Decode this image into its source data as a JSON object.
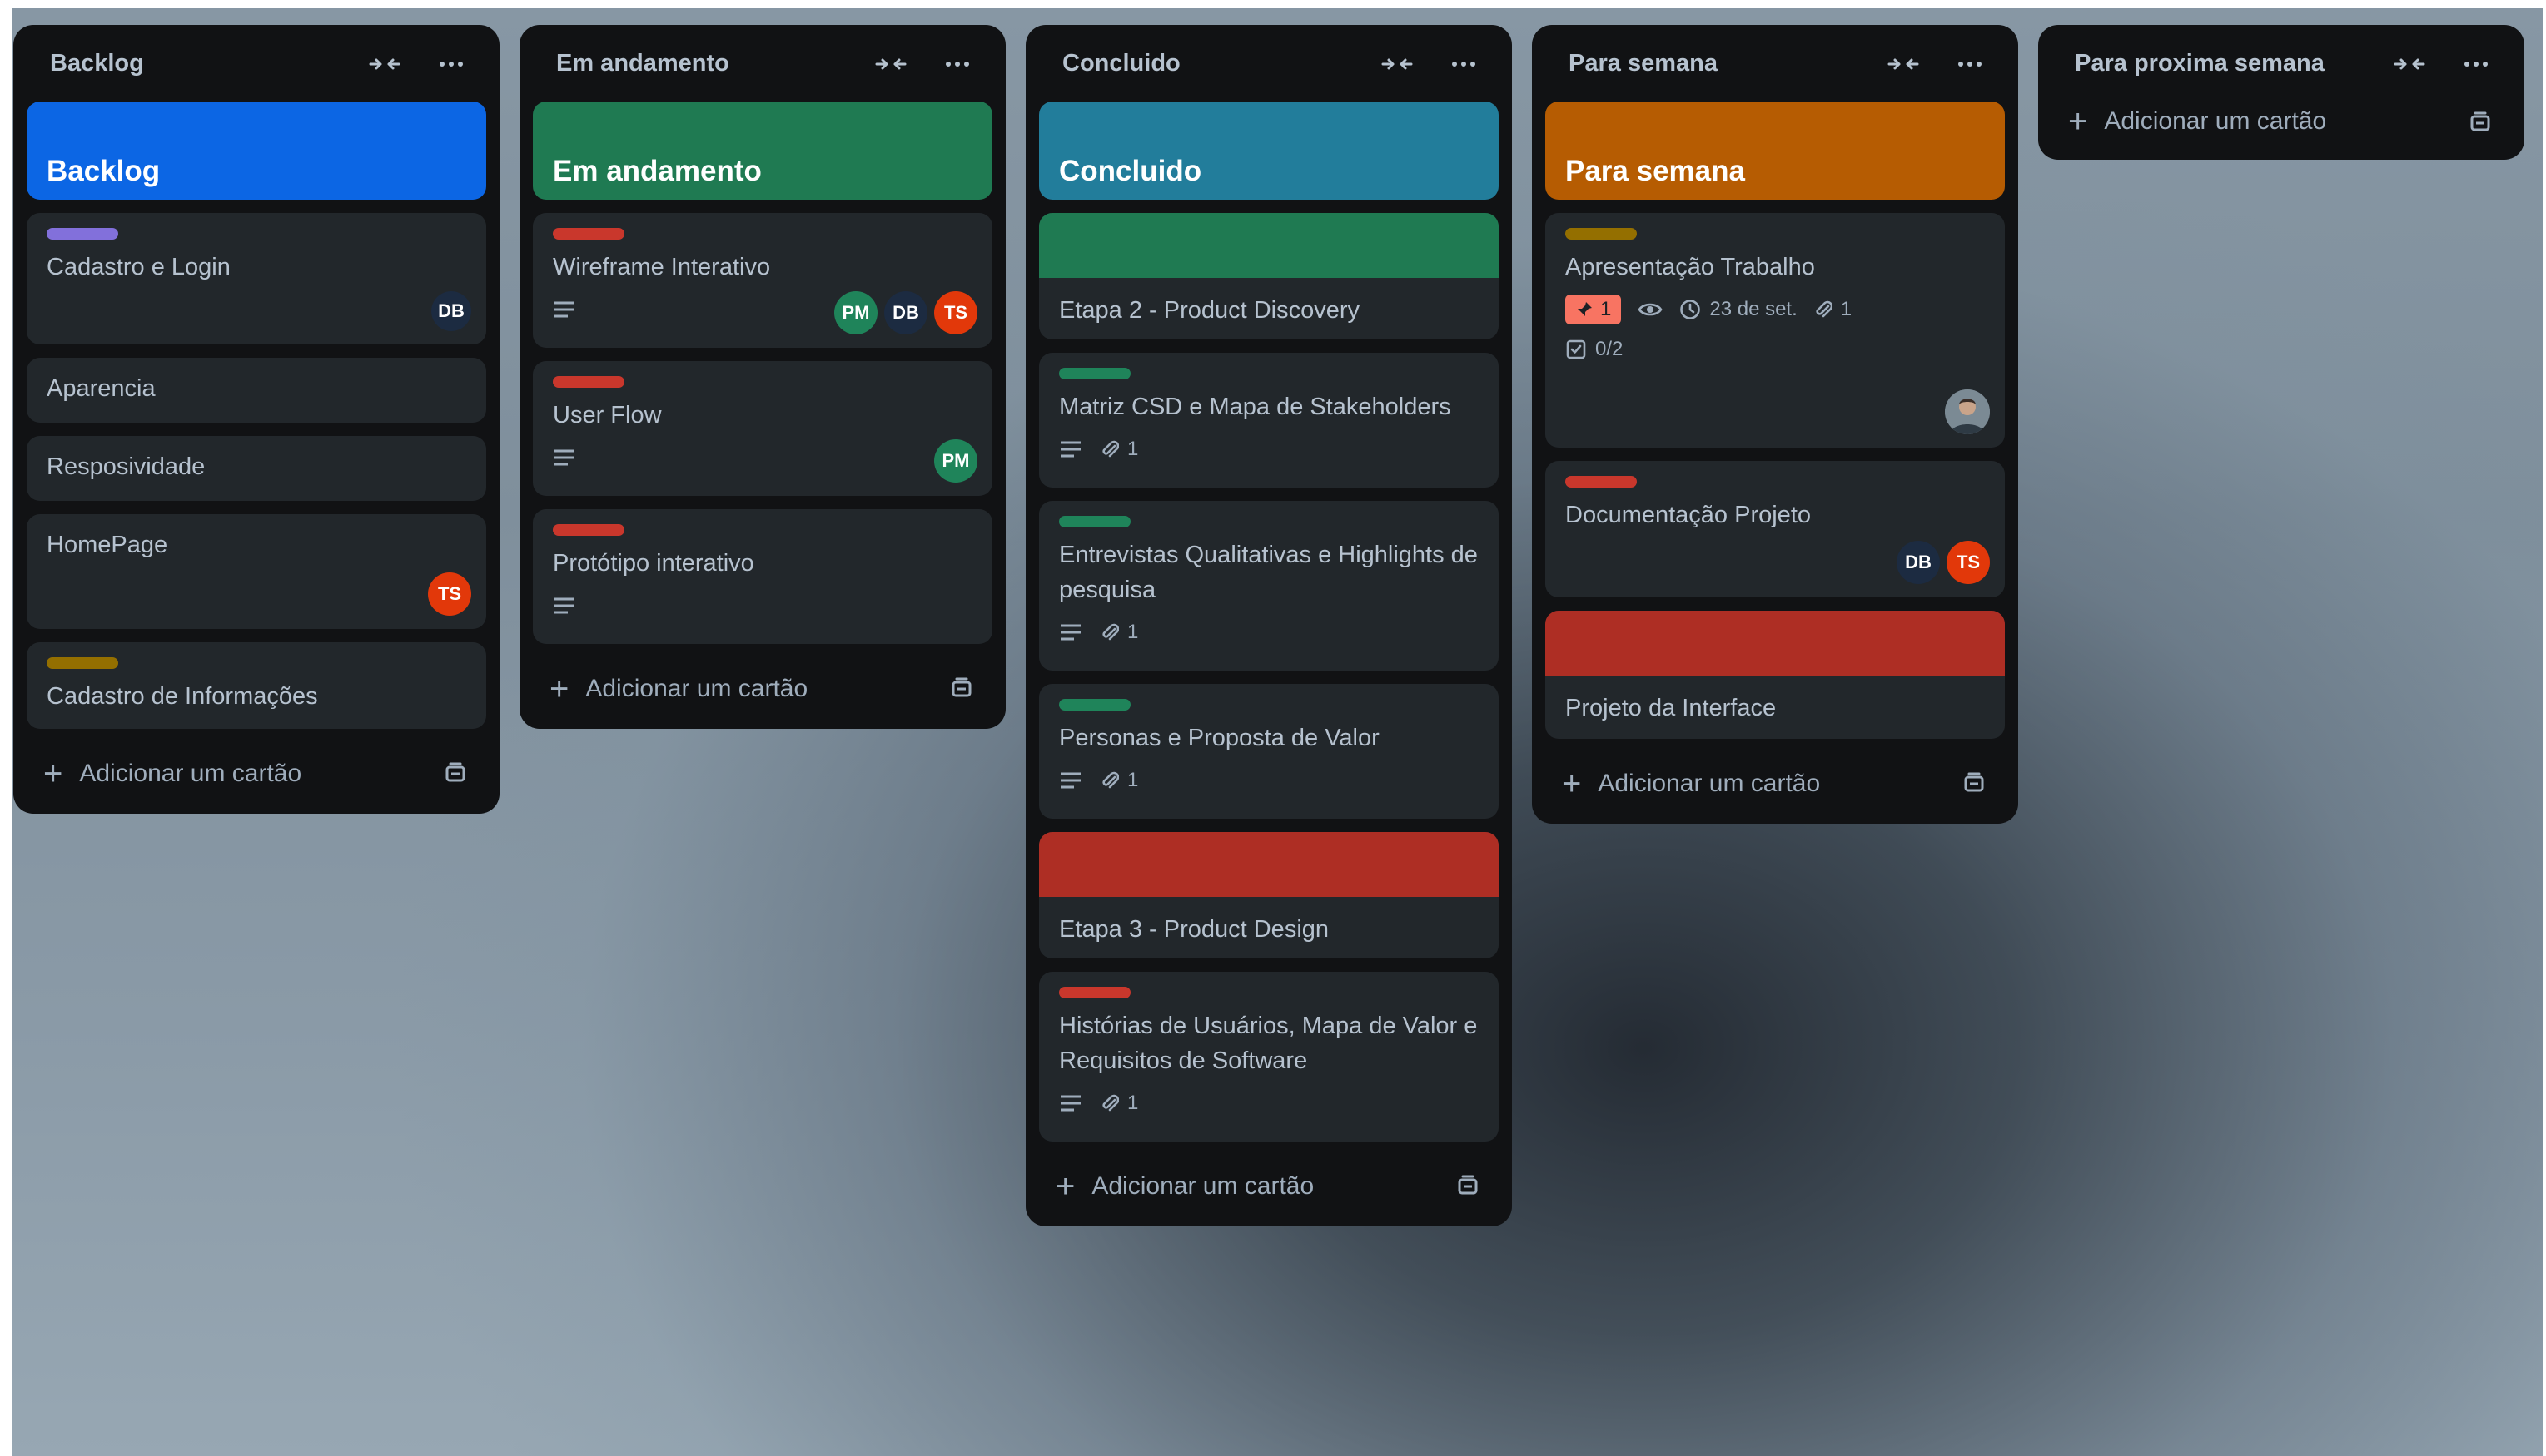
{
  "board": {
    "add_card_label": "Adicionar um cartão",
    "colors": {
      "list_bg": "#111214",
      "card_bg": "#22272b",
      "text": "#b6c2cf",
      "blue": "#0055cc",
      "green": "#216e4e",
      "teal": "#206a83",
      "orange": "#a54800",
      "red": "#ae2e24",
      "purple": "#6e5dc6",
      "label_red": "#c9372c",
      "label_green": "#1f845a",
      "label_yellow": "#946f00"
    },
    "lists": [
      {
        "title": "Backlog",
        "header_card": {
          "title": "Backlog",
          "color": "#0055cc"
        },
        "cards": [
          {
            "title": "Cadastro e Login",
            "label_color": "#6e5dc6",
            "members": [
              "DB"
            ]
          },
          {
            "title": "Aparencia"
          },
          {
            "title": "Resposividade"
          },
          {
            "title": "HomePage",
            "members": [
              "TS"
            ]
          },
          {
            "title": "Cadastro de Informações",
            "label_color": "#946f00"
          }
        ]
      },
      {
        "title": "Em andamento",
        "header_card": {
          "title": "Em andamento",
          "color": "#216e4e"
        },
        "cards": [
          {
            "title": "Wireframe Interativo",
            "label_color": "#c9372c",
            "has_description": true,
            "members": [
              "PM",
              "DB",
              "TS"
            ]
          },
          {
            "title": "User Flow",
            "label_color": "#c9372c",
            "has_description": true,
            "members": [
              "PM"
            ]
          },
          {
            "title": "Protótipo interativo",
            "label_color": "#c9372c",
            "has_description": true
          }
        ]
      },
      {
        "title": "Concluido",
        "header_card": {
          "title": "Concluido",
          "color": "#206a83"
        },
        "cards": [
          {
            "title": "Etapa 2 - Product Discovery",
            "cover_color": "#216e4e"
          },
          {
            "title": "Matriz CSD e Mapa de Stakeholders",
            "label_color": "#1f845a",
            "has_description": true,
            "attachments": "1"
          },
          {
            "title": "Entrevistas Qualitativas e Highlights de pesquisa",
            "label_color": "#1f845a",
            "has_description": true,
            "attachments": "1"
          },
          {
            "title": "Personas e Proposta de Valor",
            "label_color": "#1f845a",
            "has_description": true,
            "attachments": "1"
          },
          {
            "title": "Etapa 3 - Product Design",
            "cover_color": "#ae2e24"
          },
          {
            "title": "Histórias de Usuários, Mapa de Valor e Requisitos de Software",
            "label_color": "#c9372c",
            "has_description": true,
            "attachments": "1"
          }
        ]
      },
      {
        "title": "Para semana",
        "header_card": {
          "title": "Para semana",
          "color": "#a54800"
        },
        "cards": [
          {
            "title": "Apresentação Trabalho",
            "label_color": "#946f00",
            "notifications": "1",
            "watching": true,
            "due": "23 de set.",
            "attachments": "1",
            "checklist": "0/2",
            "members": [
              "photo"
            ]
          },
          {
            "title": "Documentação Projeto",
            "label_color": "#c9372c",
            "members": [
              "DB",
              "TS"
            ]
          },
          {
            "title": "Projeto da Interface",
            "cover_color": "#ae2e24"
          }
        ]
      },
      {
        "title": "Para proxima semana",
        "cards": []
      }
    ],
    "member_colors": {
      "DB": "#1c2b41",
      "TS": "#e2380a",
      "PM": "#1f845a"
    }
  }
}
